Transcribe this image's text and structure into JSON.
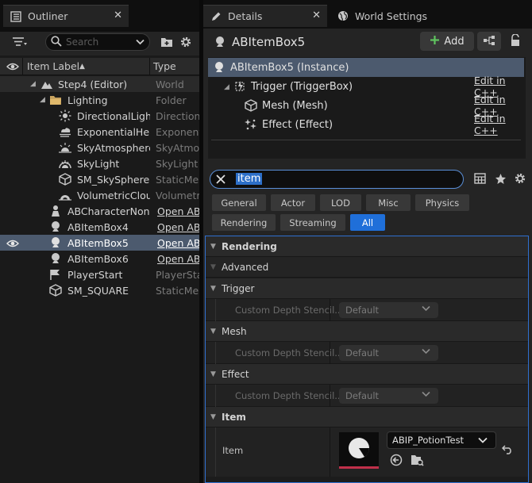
{
  "outliner": {
    "tab_title": "Outliner",
    "search_placeholder": "Search",
    "col_label": "Item Label",
    "col_sort": "▲",
    "col_type": "Type",
    "rows": [
      {
        "label": "Step4 (Editor)",
        "type": "World"
      },
      {
        "label": "Lighting",
        "type": "Folder"
      },
      {
        "label": "DirectionalLight",
        "type": "Directional"
      },
      {
        "label": "ExponentialHeightFog",
        "type": "Exponenti"
      },
      {
        "label": "SkyAtmosphere",
        "type": "SkyAtmos"
      },
      {
        "label": "SkyLight",
        "type": "SkyLight"
      },
      {
        "label": "SM_SkySphere",
        "type": "StaticMesh"
      },
      {
        "label": "VolumetricCloud",
        "type": "Volumetric"
      },
      {
        "label": "ABCharacterNonPlayer",
        "type": "Open ABC"
      },
      {
        "label": "ABItemBox4",
        "type": "Open ABI"
      },
      {
        "label": "ABItemBox5",
        "type": "Open ABI"
      },
      {
        "label": "ABItemBox6",
        "type": "Open ABI"
      },
      {
        "label": "PlayerStart",
        "type": "PlayerStart"
      },
      {
        "label": "SM_SQUARE",
        "type": "StaticMesh"
      }
    ]
  },
  "details": {
    "tab_title": "Details",
    "world_settings_tab": "World Settings",
    "actor_name": "ABItemBox5",
    "add_label": "Add",
    "components": [
      {
        "label": "ABItemBox5 (Instance)",
        "edit": ""
      },
      {
        "label": "Trigger (TriggerBox)",
        "edit": "Edit in C++"
      },
      {
        "label": "Mesh (Mesh)",
        "edit": "Edit in C++"
      },
      {
        "label": "Effect (Effect)",
        "edit": "Edit in C++"
      }
    ],
    "filter_text": "item",
    "categories": [
      "General",
      "Actor",
      "LOD",
      "Misc",
      "Physics",
      "Rendering",
      "Streaming",
      "All"
    ],
    "sections": {
      "rendering": "Rendering",
      "advanced": "Advanced",
      "trigger": "Trigger",
      "mesh": "Mesh",
      "effect": "Effect",
      "item": "Item"
    },
    "custom_depth_label": "Custom Depth Stencil...",
    "default_value": "Default",
    "item_label": "Item",
    "item_asset": "ABIP_PotionTest"
  },
  "colors": {
    "accent": "#1f6fd9",
    "selection": "#4c5a6e",
    "add_green": "#5fc45f"
  }
}
